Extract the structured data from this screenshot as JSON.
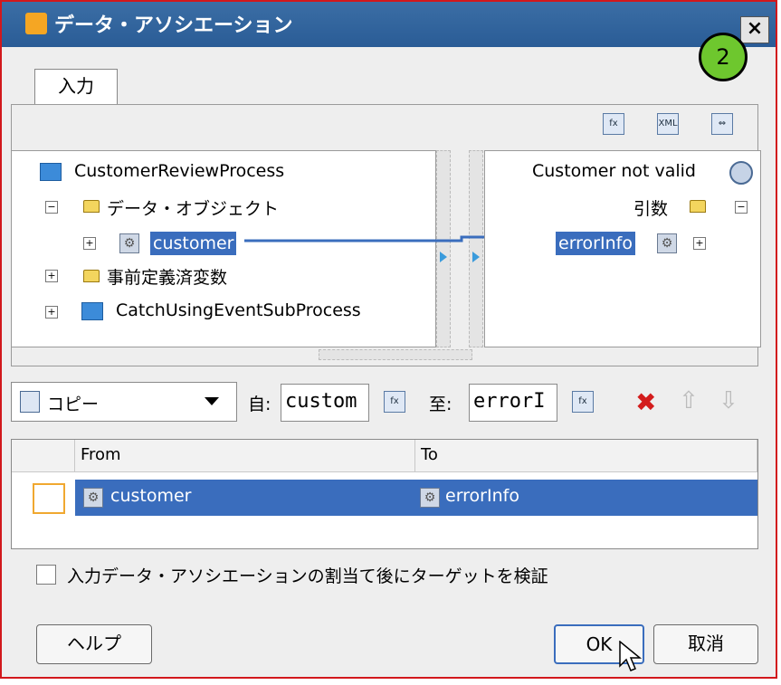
{
  "window": {
    "title": "データ・アソシエーション",
    "close_label": "×",
    "step_badge": "2"
  },
  "tabs": [
    {
      "label": "入力"
    }
  ],
  "toolbar_icons": [
    "expression-builder-icon",
    "xml-icon",
    "auto-map-icon"
  ],
  "left_tree": {
    "root": "CustomerReviewProcess",
    "items": [
      {
        "label": "データ・オブジェクト"
      },
      {
        "label": "customer"
      },
      {
        "label": "事前定義済変数"
      },
      {
        "label": "CatchUsingEventSubProcess"
      }
    ]
  },
  "right_tree": {
    "root": "Customer not valid",
    "items": [
      {
        "label": "引数"
      },
      {
        "label": "errorInfo"
      }
    ]
  },
  "mapping": {
    "operation": "コピー",
    "from_label": "自:",
    "from_value": "custom",
    "to_label": "至:",
    "to_value": "errorI"
  },
  "table": {
    "columns": [
      "From",
      "To"
    ],
    "rows": [
      {
        "from": "customer",
        "to": "errorInfo"
      }
    ]
  },
  "validate_checkbox": {
    "label": "入力データ・アソシエーションの割当て後にターゲットを検証",
    "checked": false
  },
  "buttons": {
    "help": "ヘルプ",
    "ok": "OK",
    "cancel": "取消"
  },
  "colors": {
    "selection": "#3a6dbd",
    "title_bar": "#2a5c96",
    "badge": "#6ec72e",
    "delete": "#d31c1c"
  }
}
